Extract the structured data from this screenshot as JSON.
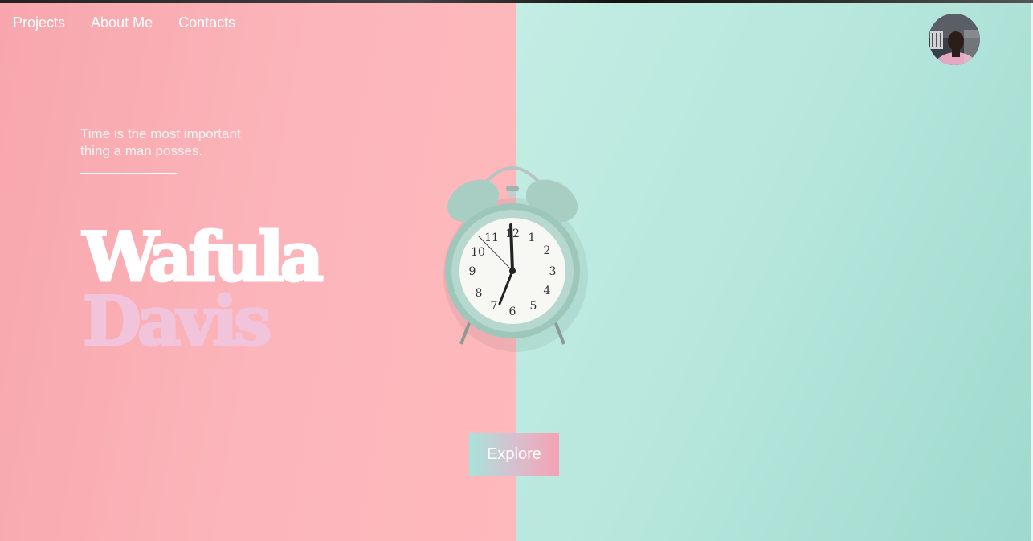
{
  "nav": {
    "items": [
      "Projects",
      "About Me",
      "Contacts"
    ]
  },
  "profile": {
    "avatar_icon": "user-avatar-photo"
  },
  "hero": {
    "tagline_line1": "Time is the most important",
    "tagline_line2": "thing a man posses.",
    "first_name": "Wafula",
    "last_name": "Davis",
    "image_icon": "alarm-clock-image",
    "cta_label": "Explore"
  },
  "colors": {
    "left_background": "#fcb6bb",
    "right_background": "#b5e6dc",
    "first_name": "#ffffff",
    "last_name": "#f1c4dc",
    "button_gradient_start": "#a8e3da",
    "button_gradient_end": "#f6a1b4"
  }
}
